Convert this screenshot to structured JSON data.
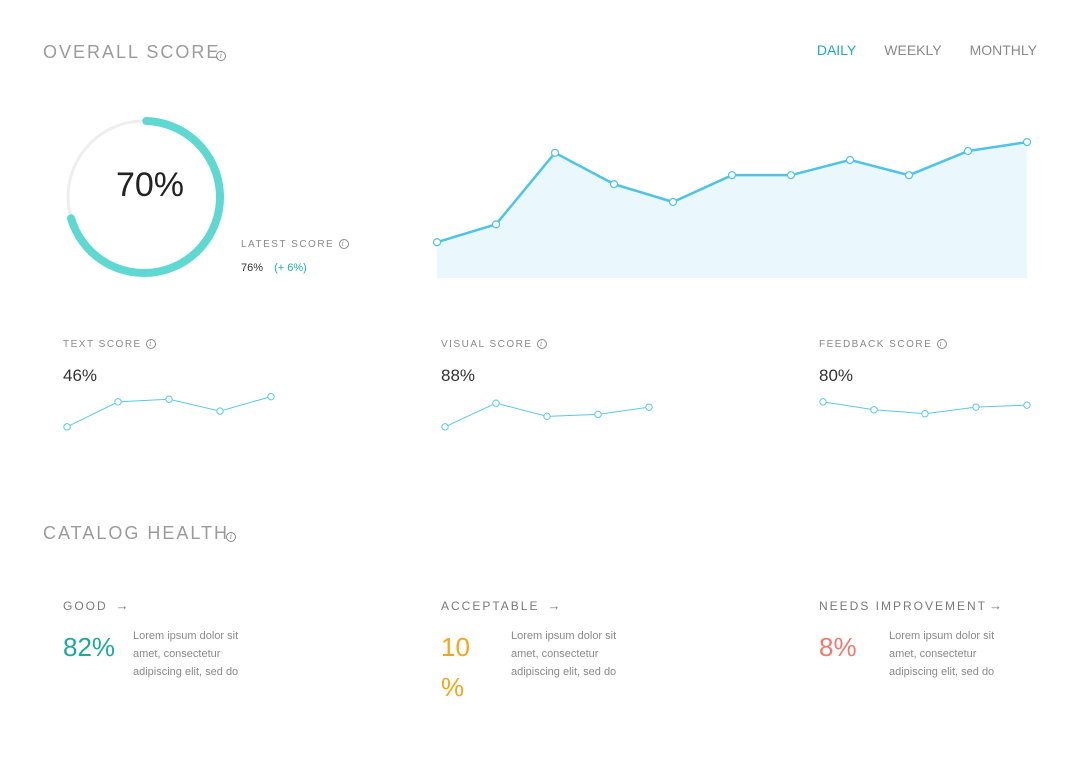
{
  "overall": {
    "title": "OVERALL SCORE",
    "score_value": "70%",
    "score_fraction": 0.7,
    "latest_label": "LATEST SCORE",
    "latest_value": "76%",
    "latest_change": "(+ 6%)"
  },
  "tabs": [
    {
      "label": "DAILY",
      "active": true
    },
    {
      "label": "WEEKLY",
      "active": false
    },
    {
      "label": "MONTHLY",
      "active": false
    }
  ],
  "main_chart": {
    "type": "area",
    "values": [
      2,
      3,
      7,
      5.25,
      4.25,
      5.75,
      5.75,
      6.6,
      5.75,
      7.1,
      7.6
    ],
    "ylim": [
      0,
      8.5
    ],
    "line_color": "#4ec3e8",
    "fill_color": "#eaf7fc"
  },
  "sub_scores": [
    {
      "label": "TEXT SCORE",
      "value": "46%",
      "trend": [
        1,
        2.9,
        3.1,
        2.2,
        3.3
      ]
    },
    {
      "label": "VISUAL SCORE",
      "value": "88%",
      "trend": [
        1,
        2.8,
        1.8,
        1.95,
        2.5
      ]
    },
    {
      "label": "FEEDBACK SCORE",
      "value": "80%",
      "trend": [
        2.9,
        2.3,
        2.0,
        2.5,
        2.65
      ]
    }
  ],
  "catalog": {
    "title": "CATALOG HEALTH",
    "cards": [
      {
        "label": "GOOD",
        "value": "82%",
        "color": "#1aab9b",
        "desc_1": "Lorem ipsum dolor sit",
        "desc_2": "amet, consectetur",
        "desc_3": "adipiscing elit, sed do"
      },
      {
        "label": "ACCEPTABLE",
        "value": "10 %",
        "color": "#f2a71b",
        "desc_1": "Lorem ipsum dolor sit",
        "desc_2": "amet, consectetur",
        "desc_3": "adipiscing elit, sed do"
      },
      {
        "label": "NEEDS IMPROVEMENT",
        "value": "8%",
        "color": "#f07a6e",
        "desc_1": "Lorem ipsum dolor sit",
        "desc_2": "amet, consectetur",
        "desc_3": "adipiscing elit, sed do"
      }
    ]
  },
  "colors": {
    "accent": "#20a8c9",
    "donut": "#5ed8d0",
    "donut_track": "#eeeeee",
    "trend_line": "#5cc8ea"
  }
}
